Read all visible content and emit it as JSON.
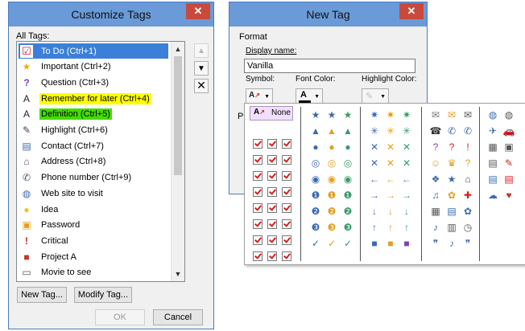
{
  "customize_dialog": {
    "title": "Customize Tags",
    "close_glyph": "✕",
    "all_tags_label": "All Tags:",
    "tags": [
      {
        "label": "To Do (Ctrl+1)",
        "icon": "checkbox-icon",
        "selected": true
      },
      {
        "label": "Important (Ctrl+2)",
        "icon": "star-icon"
      },
      {
        "label": "Question (Ctrl+3)",
        "icon": "question-icon"
      },
      {
        "label": "Remember for later (Ctrl+4)",
        "icon": "highlighter-a-icon",
        "highlight": "#ffff00"
      },
      {
        "label": "Definition (Ctrl+5)",
        "icon": "highlighter-a-icon",
        "highlight": "#44dd00"
      },
      {
        "label": "Highlight (Ctrl+6)",
        "icon": "pen-icon"
      },
      {
        "label": "Contact (Ctrl+7)",
        "icon": "contact-card-icon"
      },
      {
        "label": "Address (Ctrl+8)",
        "icon": "house-icon"
      },
      {
        "label": "Phone number (Ctrl+9)",
        "icon": "phone-icon"
      },
      {
        "label": "Web site to visit",
        "icon": "globe-icon"
      },
      {
        "label": "Idea",
        "icon": "lightbulb-icon"
      },
      {
        "label": "Password",
        "icon": "lock-icon"
      },
      {
        "label": "Critical",
        "icon": "exclamation-icon"
      },
      {
        "label": "Project A",
        "icon": "red-square-icon"
      },
      {
        "label": "Movie to see",
        "icon": "film-icon"
      }
    ],
    "new_tag_button": "New Tag...",
    "modify_tag_button": "Modify Tag...",
    "ok_button": "OK",
    "cancel_button": "Cancel"
  },
  "new_tag_dialog": {
    "title": "New Tag",
    "close_glyph": "✕",
    "format_label": "Format",
    "display_name_label": "Display name:",
    "display_name_value": "Vanilla",
    "symbol_label": "Symbol:",
    "font_color_label": "Font Color:",
    "highlight_color_label": "Highlight Color:",
    "partial_label": "Pr"
  },
  "symbol_palette": {
    "none_label": "None"
  }
}
